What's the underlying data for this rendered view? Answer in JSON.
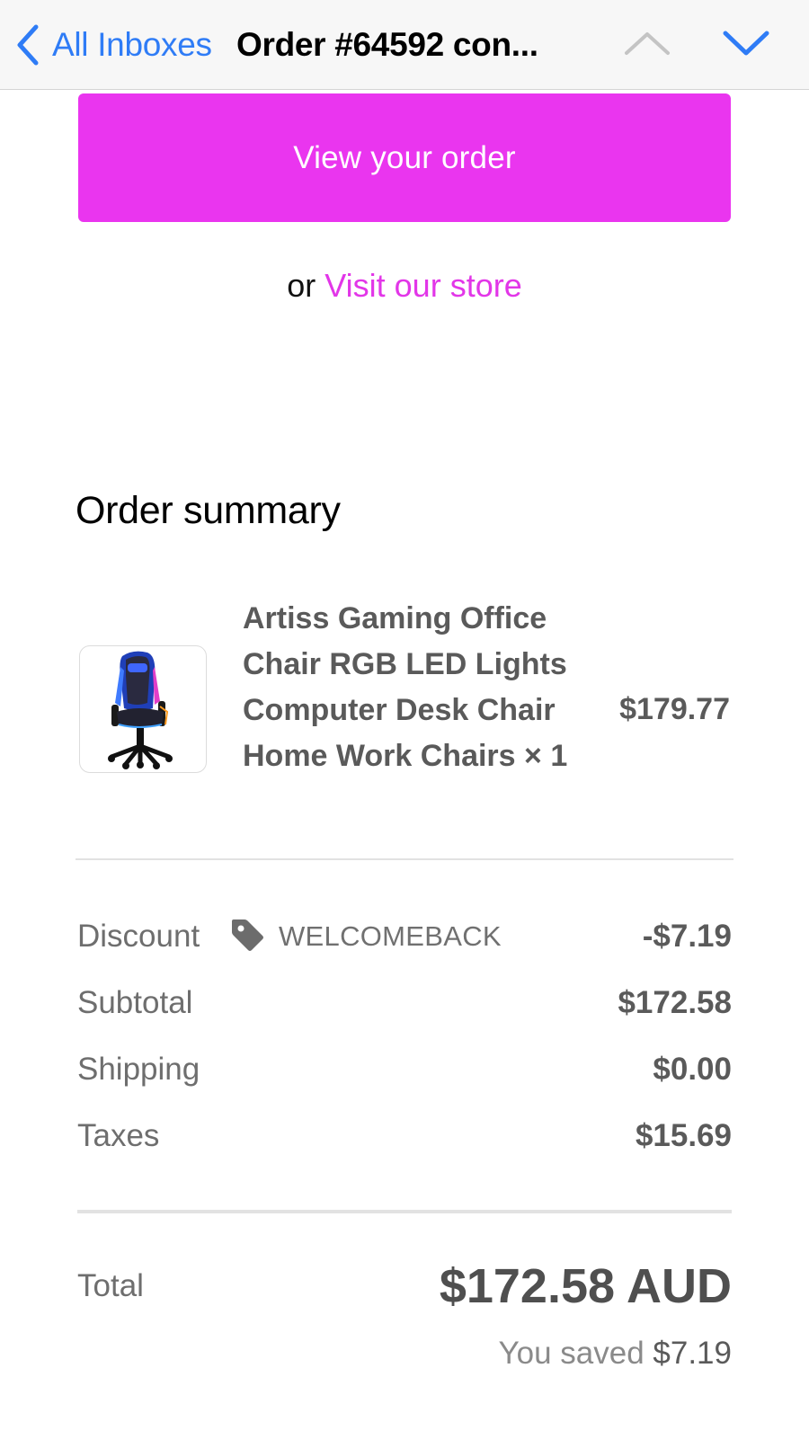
{
  "nav": {
    "back_label": "All Inboxes",
    "title": "Order #64592 con...",
    "colors": {
      "link": "#2f7cf6",
      "bar_background": "#f7f7f7"
    },
    "icons": {
      "back": "chevron-left-icon",
      "previous": "chevron-up-icon",
      "next": "chevron-down-icon"
    }
  },
  "email": {
    "view_order_button": "View your order",
    "or_text": "or",
    "visit_store_link": "Visit our store",
    "colors": {
      "accent": "#ea35ef"
    }
  },
  "order_summary": {
    "heading": "Order summary",
    "item": {
      "name": "Artiss Gaming Office Chair RGB LED Lights Computer Desk Chair Home Work Chairs",
      "quantity": "× 1",
      "price": "$179.77",
      "image": "gaming-chair-image"
    },
    "discount": {
      "label": "Discount",
      "code": "WELCOMEBACK",
      "icon": "tag-icon",
      "value": "-$7.19"
    },
    "subtotal": {
      "label": "Subtotal",
      "value": "$172.58"
    },
    "shipping": {
      "label": "Shipping",
      "value": "$0.00"
    },
    "taxes": {
      "label": "Taxes",
      "value": "$15.69"
    },
    "total": {
      "label": "Total",
      "value": "$172.58 AUD"
    },
    "saved": {
      "prefix": "You saved",
      "amount": "$7.19"
    }
  }
}
